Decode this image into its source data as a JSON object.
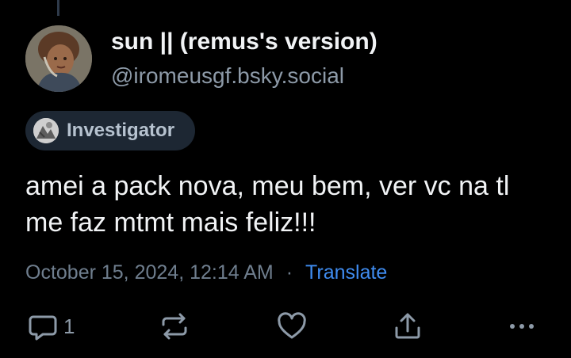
{
  "post": {
    "author": {
      "display_name": "sun || (remus's version)",
      "handle": "@iromeusgf.bsky.social",
      "avatar_icon": "avatar-illustration"
    },
    "badge": {
      "label": "Investigator",
      "icon": "investigator-badge-icon"
    },
    "text": "amei a pack nova, meu bem, ver vc na tl me faz mtmt mais feliz!!!",
    "timestamp": "October 15, 2024, 12:14 AM",
    "separator": "·",
    "translate_label": "Translate",
    "actions": {
      "reply_count": "1",
      "reply_icon": "reply-icon",
      "repost_icon": "repost-icon",
      "like_icon": "heart-icon",
      "share_icon": "share-icon",
      "more_icon": "more-icon"
    }
  },
  "colors": {
    "background": "#000000",
    "text_primary": "#f1f3f5",
    "text_secondary": "#8d9aa8",
    "meta_text": "#6f7e8e",
    "link": "#3f8cf0",
    "badge_background": "#1d2733",
    "thread_line": "#2e3a4a"
  }
}
